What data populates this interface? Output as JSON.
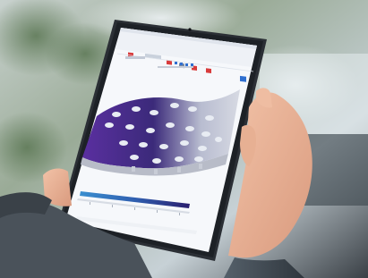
{
  "scene": {
    "background_colors": [
      "#d9e0e2",
      "#8fa08a",
      "#6d8068",
      "#b9c6cc",
      "#2a2f33"
    ],
    "tablet_frame_color": "#2b2f35",
    "screen_background": "#f6f8fb",
    "simulation_colors": {
      "surface": "#5a2fa0",
      "surface_light": "#b8bcd0",
      "gradient_start": "#3a8fd0",
      "gradient_end": "#2a1e6e",
      "accent_red": "#d83b3b"
    },
    "icons": [
      "app-logo-icon",
      "toolbar-play-icon",
      "toolbar-mesh-icon",
      "toolbar-results-icon",
      "toolbar-export-icon",
      "toolbar-blue-button-icon"
    ],
    "visible_text": []
  }
}
